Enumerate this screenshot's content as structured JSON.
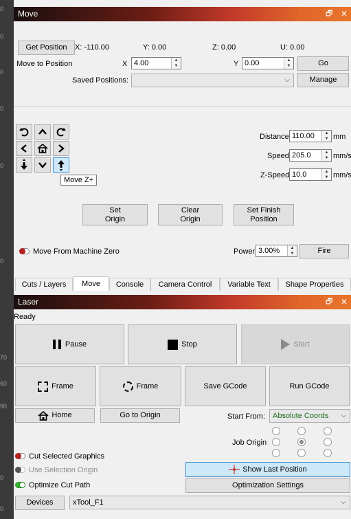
{
  "ruler": {
    "ticks": [
      "0",
      "0",
      "0",
      "0",
      "0",
      "0",
      "70",
      "60",
      "90",
      "0",
      "0"
    ]
  },
  "move_panel": {
    "title": "Move",
    "float_icon": "restore-icon",
    "close_icon": "close-icon",
    "get_position_label": "Get Position",
    "x_readout": "X: -110.00",
    "y_readout": "Y: 0.00",
    "z_readout": "Z: 0.00",
    "u_readout": "U: 0.00",
    "move_to_position_label": "Move to Position",
    "x_label": "X",
    "x_value": "4.00",
    "y_label": "Y",
    "y_value": "0.00",
    "go_label": "Go",
    "saved_positions_label": "Saved Positions:",
    "saved_positions_value": "",
    "manage_label": "Manage",
    "distance_label": "Distance",
    "distance_value": "110.00",
    "distance_unit": "mm",
    "speed_label": "Speed",
    "speed_value": "205.0",
    "speed_unit": "mm/s",
    "zspeed_label": "Z-Speed",
    "zspeed_value": "10.0",
    "zspeed_unit": "mm/s",
    "tooltip": "Move Z+",
    "set_origin_label": "Set\nOrigin",
    "clear_origin_label": "Clear\nOrigin",
    "set_finish_label": "Set Finish\nPosition",
    "move_from_zero_label": "Move From Machine Zero",
    "power_label": "Power",
    "power_value": "3.00%",
    "fire_label": "Fire"
  },
  "tabs": [
    {
      "label": "Cuts / Layers"
    },
    {
      "label": "Move"
    },
    {
      "label": "Console"
    },
    {
      "label": "Camera Control"
    },
    {
      "label": "Variable Text"
    },
    {
      "label": "Shape Properties"
    }
  ],
  "laser_panel": {
    "title": "Laser",
    "status": "Ready",
    "pause_label": "Pause",
    "stop_label": "Stop",
    "start_label": "Start",
    "frame1_label": "Frame",
    "frame2_label": "Frame",
    "save_gcode_label": "Save GCode",
    "run_gcode_label": "Run GCode",
    "home_label": "Home",
    "go_to_origin_label": "Go to Origin",
    "start_from_label": "Start From:",
    "start_from_value": "Absolute Coords",
    "job_origin_label": "Job Origin",
    "cut_selected_label": "Cut Selected Graphics",
    "use_selection_origin_label": "Use Selection Origin",
    "optimize_cut_label": "Optimize Cut Path",
    "show_last_position_label": "Show Last Position",
    "optimization_settings_label": "Optimization Settings",
    "devices_label": "Devices",
    "device_value": "xTool_F1"
  },
  "colors": {
    "accent_red": "#c0392b",
    "toggle_red": "#b22222",
    "toggle_gray": "#555555",
    "toggle_green": "#2fb52f",
    "highlight_blue": "#cde8f8"
  }
}
